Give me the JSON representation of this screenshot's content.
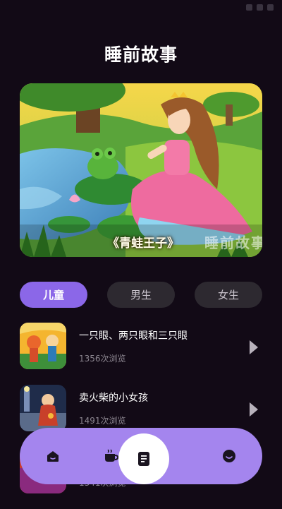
{
  "header": {
    "title": "睡前故事"
  },
  "banner": {
    "caption": "《青蛙王子》",
    "watermark": "睡前故事"
  },
  "tabs": [
    {
      "label": "儿童",
      "active": true
    },
    {
      "label": "男生",
      "active": false
    },
    {
      "label": "女生",
      "active": false
    }
  ],
  "stories": [
    {
      "title": "一只眼、两只眼和三只眼",
      "views": "1356次浏览"
    },
    {
      "title": "卖火柴的小女孩",
      "views": "1491次浏览"
    },
    {
      "title": "",
      "views": "1341次浏览"
    }
  ],
  "bottom_nav": {
    "items": [
      {
        "icon": "home-icon"
      },
      {
        "icon": "coffee-cup-icon"
      },
      {
        "icon": "document-icon",
        "active": true
      },
      {
        "icon": "smiley-icon"
      }
    ]
  },
  "colors": {
    "accent": "#8b67e8",
    "nav_bg": "#a485ee",
    "background": "#120a16",
    "tab_bg": "#2d2930"
  }
}
